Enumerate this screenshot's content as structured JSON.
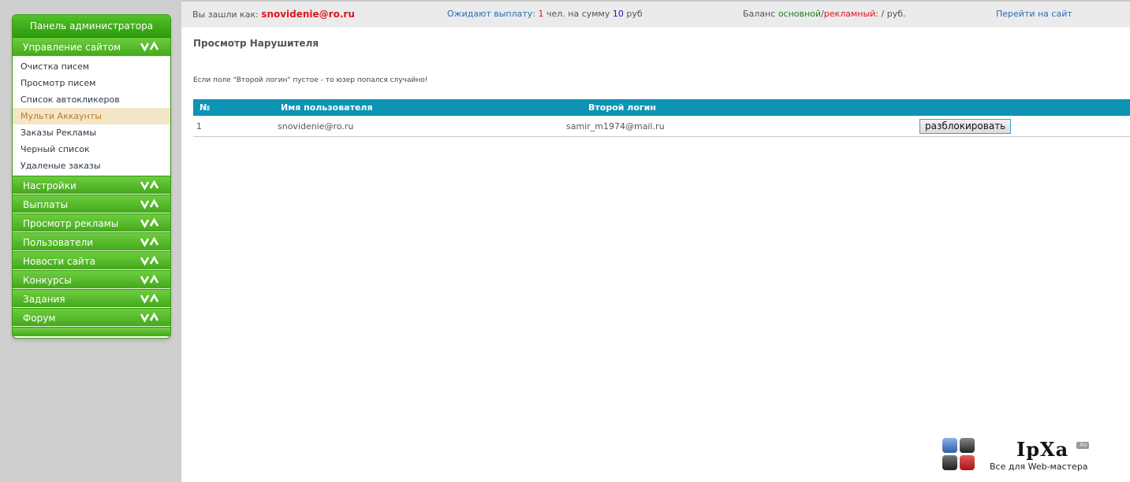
{
  "sidebar": {
    "title": "Панель администратора",
    "sections": [
      {
        "label": "Управление сайтом"
      },
      {
        "label": "Настройки"
      },
      {
        "label": "Выплаты"
      },
      {
        "label": "Просмотр рекламы"
      },
      {
        "label": "Пользователи"
      },
      {
        "label": "Новости сайта"
      },
      {
        "label": "Конкурсы"
      },
      {
        "label": "Задания"
      },
      {
        "label": "Форум"
      }
    ],
    "site_items": [
      {
        "label": "Очистка писем"
      },
      {
        "label": "Просмотр писем"
      },
      {
        "label": "Список автокликеров"
      },
      {
        "label": "Мульти Аккаунты"
      },
      {
        "label": "Заказы Рекламы"
      },
      {
        "label": "Черный список"
      },
      {
        "label": "Удаленые заказы"
      }
    ],
    "active_item": "Мульти Аккаунты",
    "icon": "expand-collapse-chevrons-icon"
  },
  "topbar": {
    "logged_in_label": "Вы зашли как:",
    "logged_in_user": "snovidenie@ro.ru",
    "pending_label": "Ожидают выплату:",
    "pending_count": "1",
    "pending_mid": "чел. на сумму",
    "pending_sum": "10",
    "pending_currency": "руб",
    "balance_label": "Баланс",
    "balance_main": "основной",
    "balance_sep": "/",
    "balance_ad": "рекламный",
    "balance_colon": ":",
    "balance_value": "/ руб.",
    "go_to_site": "Перейти на сайт"
  },
  "main": {
    "title": "Просмотр Нарушителя",
    "notice": "Если поле \"Второй логин\" пустое - то юзер попался случайно!",
    "table": {
      "headers": [
        "№",
        "Имя пользователя",
        "Второй логин",
        ""
      ],
      "rows": [
        {
          "num": "1",
          "user": "snovidenie@ro.ru",
          "second_login": "samir_m1974@mail.ru",
          "action": "разблокировать"
        }
      ]
    }
  },
  "watermark": {
    "brand": "IpXa",
    "tld": ".RU",
    "tagline": "Все для Web-мастера"
  },
  "colors": {
    "accent_green": "#43a91b",
    "table_header": "#0d93b3",
    "active_item_bg": "#f3e6c6",
    "active_item_text": "#c0762c"
  }
}
